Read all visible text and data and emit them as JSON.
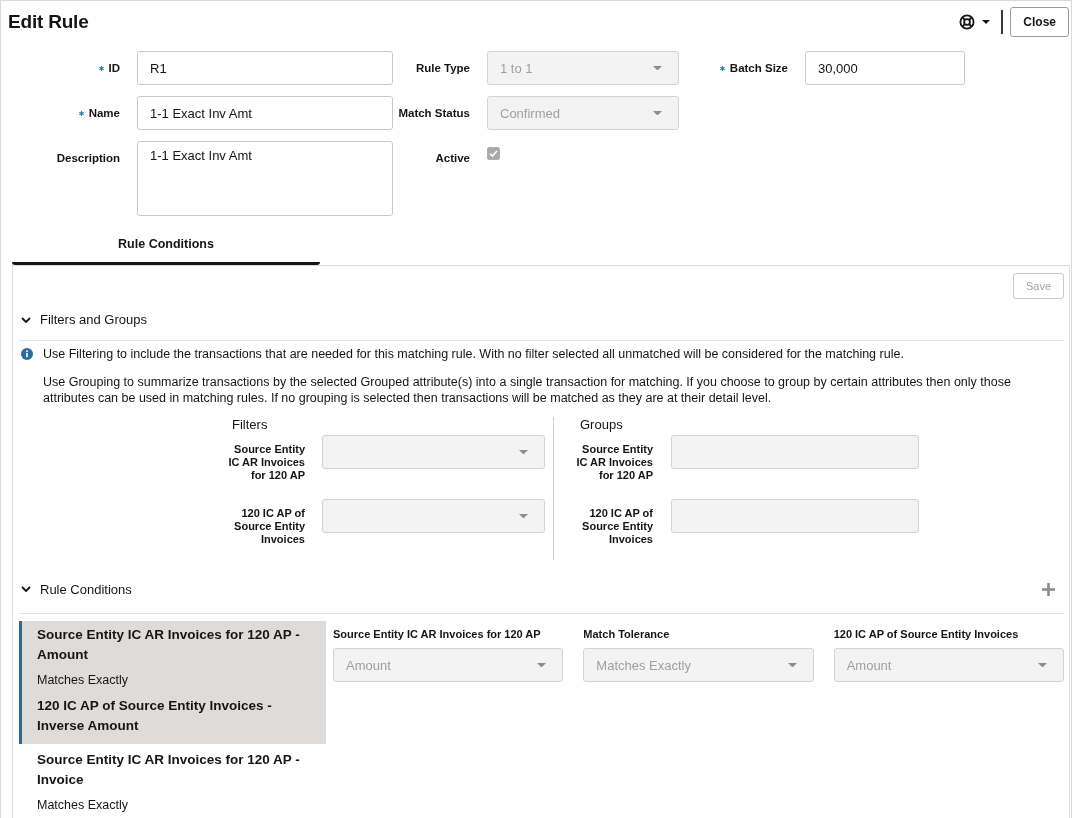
{
  "page": {
    "title": "Edit Rule"
  },
  "toolbar": {
    "close_label": "Close"
  },
  "form": {
    "rows": [
      [
        {
          "kind": "text",
          "label": "ID",
          "required": true,
          "value": "R1"
        },
        {
          "kind": "select",
          "label": "Rule Type",
          "value": "1 to 1",
          "disabled": true
        },
        {
          "kind": "text",
          "label": "Batch Size",
          "required": true,
          "value": "30,000"
        }
      ],
      [
        {
          "kind": "text",
          "label": "Name",
          "required": true,
          "value": "1-1 Exact Inv Amt"
        },
        {
          "kind": "select",
          "label": "Match Status",
          "value": "Confirmed",
          "disabled": true
        }
      ],
      [
        {
          "kind": "textarea",
          "label": "Description",
          "value": "1-1 Exact Inv Amt"
        },
        {
          "kind": "checkbox",
          "label": "Active",
          "checked": true,
          "disabled": true
        }
      ]
    ]
  },
  "tabs": [
    {
      "label": "Rule Conditions",
      "selected": true
    }
  ],
  "panel": {
    "save": {
      "label": "Save",
      "disabled": true
    },
    "filters_and_groups": {
      "title": "Filters and Groups",
      "expanded": true,
      "info": "Use Filtering to include the transactions that are needed for this matching rule. With no filter selected all unmatched will be considered for the matching rule.",
      "note": "Use Grouping to summarize transactions by the selected Grouped attribute(s) into a single transaction for matching. If you choose to group by certain attributes then only those attributes can be used in matching rules. If no grouping is selected then transactions will be matched as they are at their detail level.",
      "filters": {
        "title": "Filters",
        "fields": [
          {
            "kind": "select",
            "label": "Source Entity IC AR Invoices for 120 AP",
            "disabled": true
          },
          {
            "kind": "select",
            "label": "120 IC AP of Source Entity Invoices",
            "disabled": true
          }
        ]
      },
      "groups": {
        "title": "Groups",
        "fields": [
          {
            "kind": "text",
            "label": "Source Entity IC AR Invoices for 120 AP",
            "disabled": true
          },
          {
            "kind": "text",
            "label": "120 IC AP of Source Entity Invoices",
            "disabled": true
          }
        ]
      }
    },
    "rule_conditions": {
      "title": "Rule Conditions",
      "expanded": true,
      "conditions": [
        {
          "selected": true,
          "source": "Source Entity IC AR Invoices for 120 AP - Amount",
          "tolerance": "Matches Exactly",
          "target": "120 IC AP of Source Entity Invoices - Inverse Amount"
        },
        {
          "selected": false,
          "source": "Source Entity IC AR Invoices for 120 AP - Invoice",
          "tolerance": "Matches Exactly"
        }
      ],
      "editor": [
        {
          "label": "Source Entity IC AR Invoices for 120 AP",
          "value": "Amount",
          "disabled": true
        },
        {
          "label": "Match Tolerance",
          "value": "Matches Exactly",
          "disabled": true
        },
        {
          "label": "120 IC AP of Source Entity Invoices",
          "value": "Amount",
          "disabled": true
        }
      ]
    }
  }
}
